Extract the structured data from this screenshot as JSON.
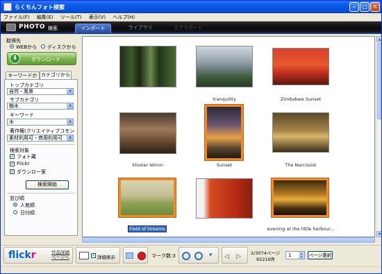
{
  "window": {
    "title": "らくちんフォト検索"
  },
  "menu": [
    "ファイル(F)",
    "編集(E)",
    "ツール(T)",
    "表示(V)",
    "ヘルプ(H)"
  ],
  "header": {
    "brand": "PHOTO",
    "brand_sub": "検索",
    "tabs": [
      {
        "label": "インポート",
        "state": "active"
      },
      {
        "label": "ライブラリ",
        "state": "normal"
      },
      {
        "label": "エクスポート",
        "state": "disabled"
      }
    ]
  },
  "left": {
    "source_label": "取得先",
    "source_options": [
      {
        "label": "WEBから",
        "selected": true
      },
      {
        "label": "ディスクから",
        "selected": false
      }
    ],
    "download_label": "ダウンロード",
    "tabs": [
      "キーワードから",
      "カテゴリから"
    ],
    "active_tab": 1,
    "top_category": {
      "label": "トップカテゴリ",
      "value": "自然・風景"
    },
    "sub_category": {
      "label": "サブカテゴリ",
      "value": "樹木"
    },
    "keyword": {
      "label": "キーワード",
      "value": "木"
    },
    "license": {
      "label": "著作権(クリエイティブコモンズ)",
      "value": "素材利用可・商用利用可"
    },
    "target": {
      "label": "検索対象",
      "items": [
        {
          "label": "フォト蔵",
          "checked": true
        },
        {
          "label": "Flickr",
          "checked": true
        },
        {
          "label": "ダウンロー室",
          "checked": true
        }
      ]
    },
    "search_button": "検索開始",
    "order": {
      "label": "並び順",
      "options": [
        {
          "label": "人気順",
          "selected": true
        },
        {
          "label": "日付順",
          "selected": false
        }
      ]
    }
  },
  "gallery": {
    "items": [
      {
        "caption": "",
        "selected": false,
        "highlight": false
      },
      {
        "caption": "tranquility",
        "selected": false,
        "highlight": false
      },
      {
        "caption": "Zimbabwe Sunset",
        "selected": false,
        "highlight": false
      },
      {
        "caption": "kloster lehnin",
        "selected": false,
        "highlight": false
      },
      {
        "caption": "Sunset",
        "selected": true,
        "highlight": false
      },
      {
        "caption": "The Narcissist",
        "selected": false,
        "highlight": false
      },
      {
        "caption": "Field of Dreams",
        "selected": true,
        "highlight": true
      },
      {
        "caption": "",
        "selected": false,
        "highlight": false
      },
      {
        "caption": "evening at the little harbour...",
        "selected": true,
        "highlight": false
      }
    ]
  },
  "bottom": {
    "flickr_logo": "flickr",
    "detail_page_link": "作品詳細\nページへ",
    "detail_display_label": "詳細表示",
    "detail_display_checked": true,
    "mark_count": "マーク数:3",
    "page_info": "2/3074ページ",
    "item_count": "92216件",
    "page_input": "1",
    "page_select_label": "ページ選択"
  },
  "colors": {
    "selection_border": "#f08a24",
    "titlebar": "#0a58e6",
    "flickr_blue": "#0063dc",
    "flickr_pink": "#ff0084"
  }
}
